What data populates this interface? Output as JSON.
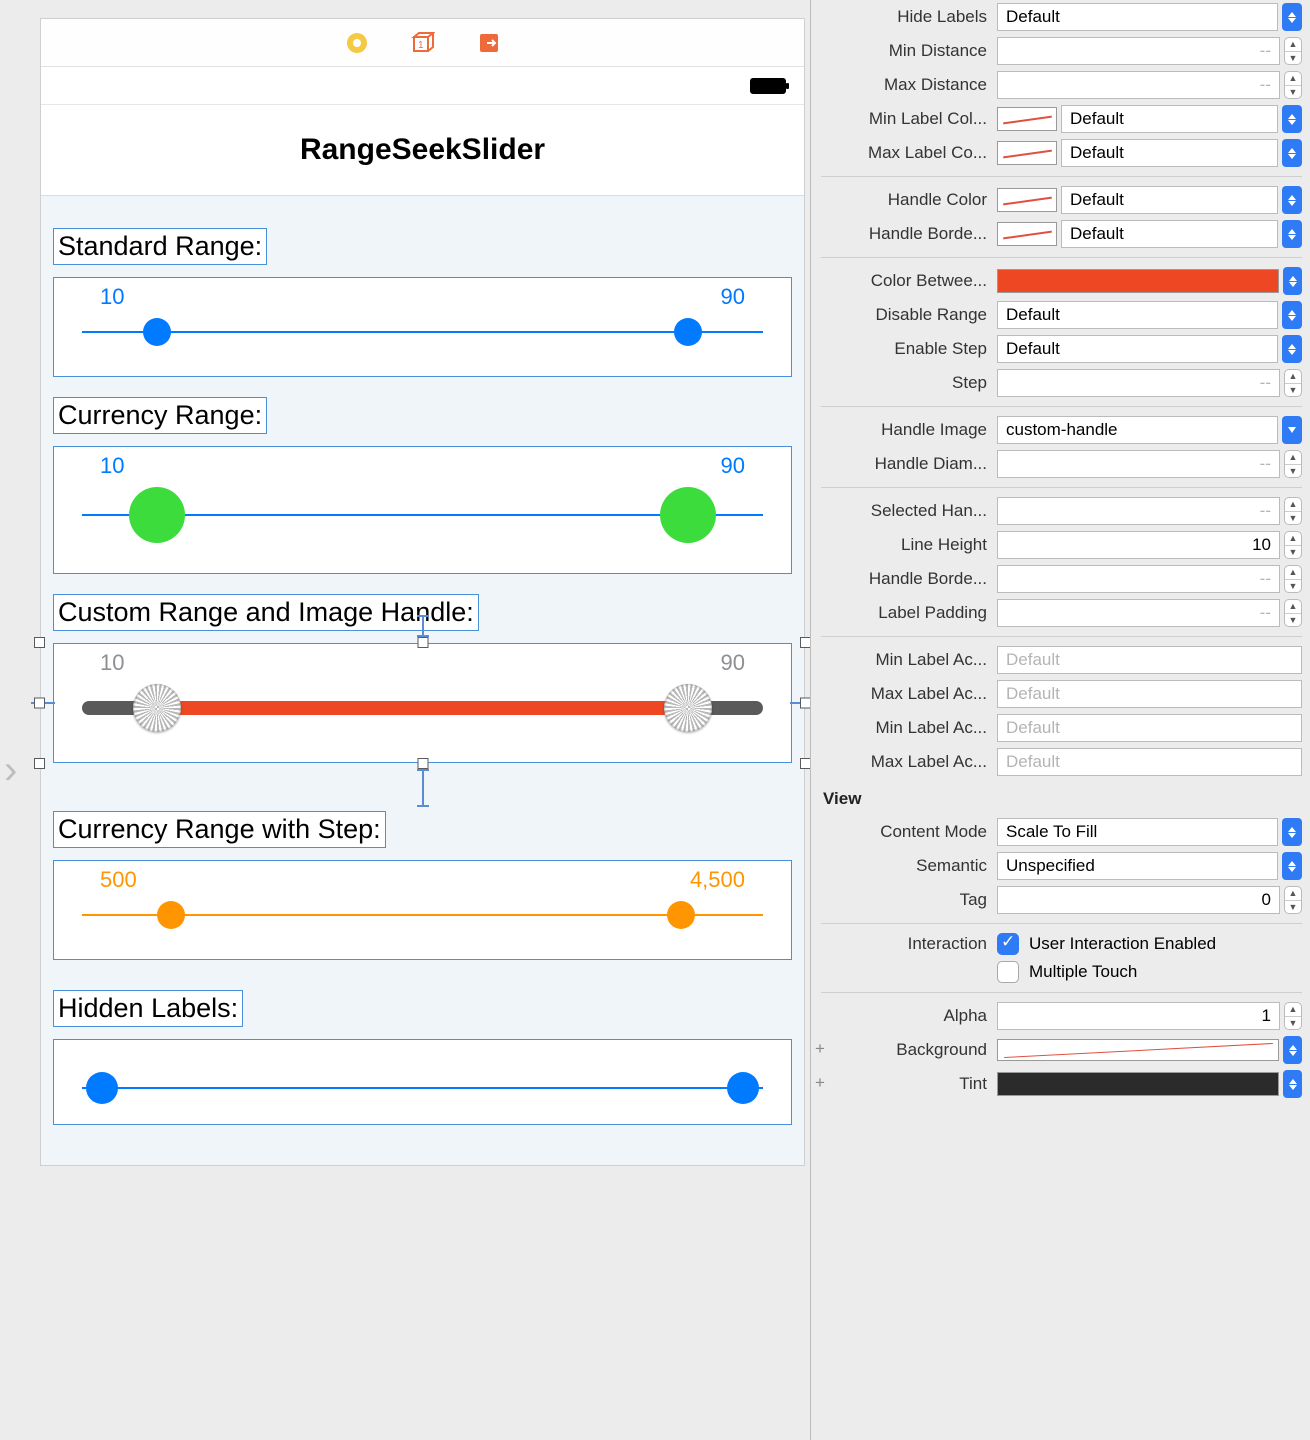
{
  "canvas": {
    "title": "RangeSeekSlider",
    "sections": {
      "standard": {
        "label": "Standard Range:",
        "min": "10",
        "max": "90"
      },
      "currency": {
        "label": "Currency Range:",
        "min": "10",
        "max": "90"
      },
      "custom": {
        "label": "Custom Range and Image Handle:",
        "min": "10",
        "max": "90"
      },
      "step": {
        "label": "Currency Range with Step:",
        "min": "500",
        "max": "4,500"
      },
      "hidden": {
        "label": "Hidden Labels:"
      }
    }
  },
  "inspector": {
    "hide_labels": {
      "label": "Hide Labels",
      "value": "Default"
    },
    "min_distance": {
      "label": "Min Distance",
      "placeholder": "--"
    },
    "max_distance": {
      "label": "Max Distance",
      "placeholder": "--"
    },
    "min_label_color": {
      "label": "Min Label Col...",
      "value": "Default"
    },
    "max_label_color": {
      "label": "Max Label Co...",
      "value": "Default"
    },
    "handle_color": {
      "label": "Handle Color",
      "value": "Default"
    },
    "handle_border_color": {
      "label": "Handle Borde...",
      "value": "Default"
    },
    "color_between": {
      "label": "Color Betwee..."
    },
    "disable_range": {
      "label": "Disable Range",
      "value": "Default"
    },
    "enable_step": {
      "label": "Enable Step",
      "value": "Default"
    },
    "step": {
      "label": "Step",
      "placeholder": "--"
    },
    "handle_image": {
      "label": "Handle Image",
      "value": "custom-handle"
    },
    "handle_diam": {
      "label": "Handle Diam...",
      "placeholder": "--"
    },
    "selected_handle": {
      "label": "Selected Han...",
      "placeholder": "--"
    },
    "line_height": {
      "label": "Line Height",
      "value": "10"
    },
    "handle_border_w": {
      "label": "Handle Borde...",
      "placeholder": "--"
    },
    "label_padding": {
      "label": "Label Padding",
      "placeholder": "--"
    },
    "min_label_ac1": {
      "label": "Min Label Ac...",
      "placeholder": "Default"
    },
    "max_label_ac1": {
      "label": "Max Label Ac...",
      "placeholder": "Default"
    },
    "min_label_ac2": {
      "label": "Min Label Ac...",
      "placeholder": "Default"
    },
    "max_label_ac2": {
      "label": "Max Label Ac...",
      "placeholder": "Default"
    },
    "view_header": "View",
    "content_mode": {
      "label": "Content Mode",
      "value": "Scale To Fill"
    },
    "semantic": {
      "label": "Semantic",
      "value": "Unspecified"
    },
    "tag": {
      "label": "Tag",
      "value": "0"
    },
    "interaction": {
      "label": "Interaction",
      "ui_enabled": "User Interaction Enabled",
      "multi_touch": "Multiple Touch"
    },
    "alpha": {
      "label": "Alpha",
      "value": "1"
    },
    "background": {
      "label": "Background"
    },
    "tint": {
      "label": "Tint"
    }
  }
}
